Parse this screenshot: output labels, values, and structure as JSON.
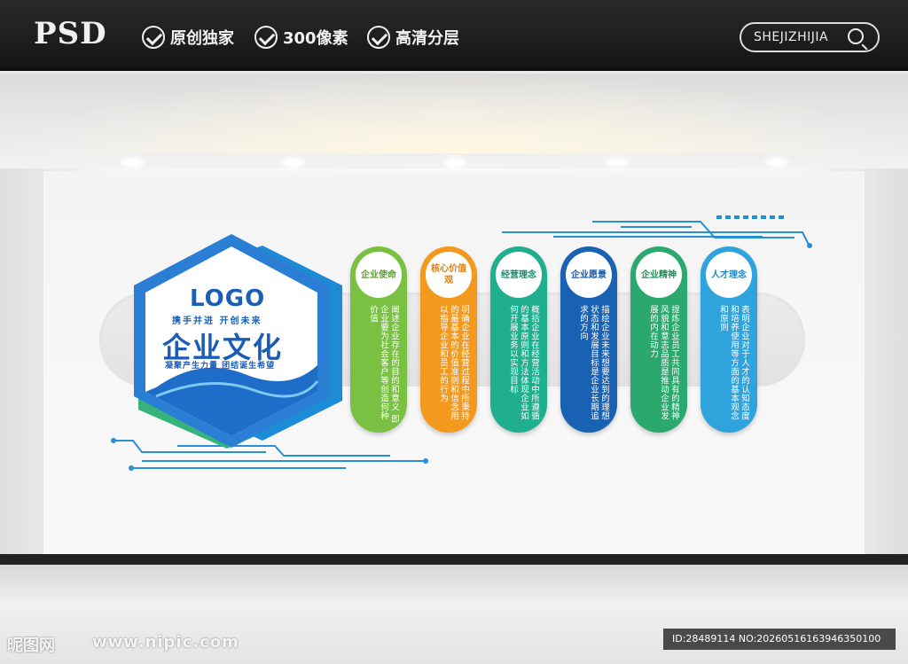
{
  "header": {
    "brand": "PSD",
    "features": [
      "原创独家",
      "300像素",
      "高清分层"
    ],
    "site": "SHEJIZHIJIA"
  },
  "logo": {
    "logo_text": "LOGO",
    "slogan_top": "携手并进 开创未来",
    "title": "企业文化",
    "slogan_bottom": "凝聚产生力量 团结诞生希望"
  },
  "pillars": [
    {
      "title": "企业使命",
      "body": "阐述企业存在的目的和意义 即企业要为社会客户等创造何种价值",
      "color": "#7ac143",
      "title_color": "#5aa02c"
    },
    {
      "title": "核心价值观",
      "body": "明确企业在经营过程中所秉持的最基本的价值准则和信念用以指导企业和员工的行为",
      "color": "#f39a1e",
      "title_color": "#e07d10"
    },
    {
      "title": "经营理念",
      "body": "概括企业在经营活动中所遵循的基本原则和方法体现企业如何开展业务以实现目标",
      "color": "#1fae8e",
      "title_color": "#138a6f"
    },
    {
      "title": "企业愿景",
      "body": "描绘企业未来想要达到的理想状态和发展目标是企业长期追求的方向",
      "color": "#1962b3",
      "title_color": "#1a5aa6"
    },
    {
      "title": "企业精神",
      "body": "提炼企业员工共同具有的精神风貌和意志品质是推动企业发展的内在动力",
      "color": "#2aa86d",
      "title_color": "#1f8e58"
    },
    {
      "title": "人才理念",
      "body": "表明企业对于人才的认知态度和培养使用等方面的基本观念和原则",
      "color": "#2ea3dc",
      "title_color": "#1f88c2"
    }
  ],
  "watermark": {
    "left": "昵图网",
    "url": "www.nipic.com",
    "id": "ID:28489114 NO:20260516163946350100"
  }
}
